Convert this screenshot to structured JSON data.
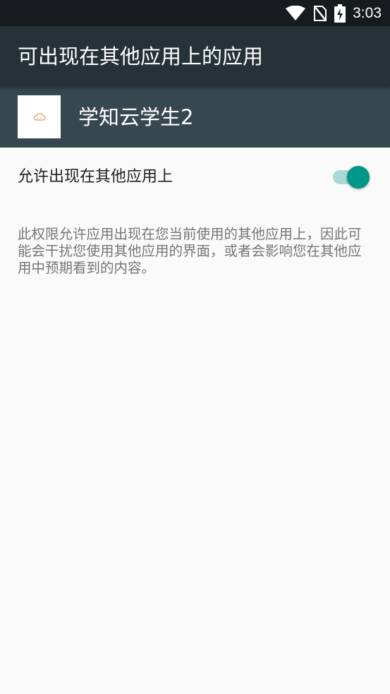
{
  "status_bar": {
    "time": "3:03",
    "icons": [
      "wifi-icon",
      "no-sim-icon",
      "battery-charging-icon"
    ]
  },
  "toolbar": {
    "title": "可出现在其他应用上的应用"
  },
  "app": {
    "name": "学知云学生2",
    "icon": "app-cloud-icon",
    "icon_color": "#e8915a"
  },
  "setting": {
    "label": "允许出现在其他应用上",
    "enabled": true,
    "accent_color": "#009688"
  },
  "description": "此权限允许应用出现在您当前使用的其他应用上，因此可能会干扰您使用其他应用的界面，或者会影响您在其他应用中预期看到的内容。"
}
